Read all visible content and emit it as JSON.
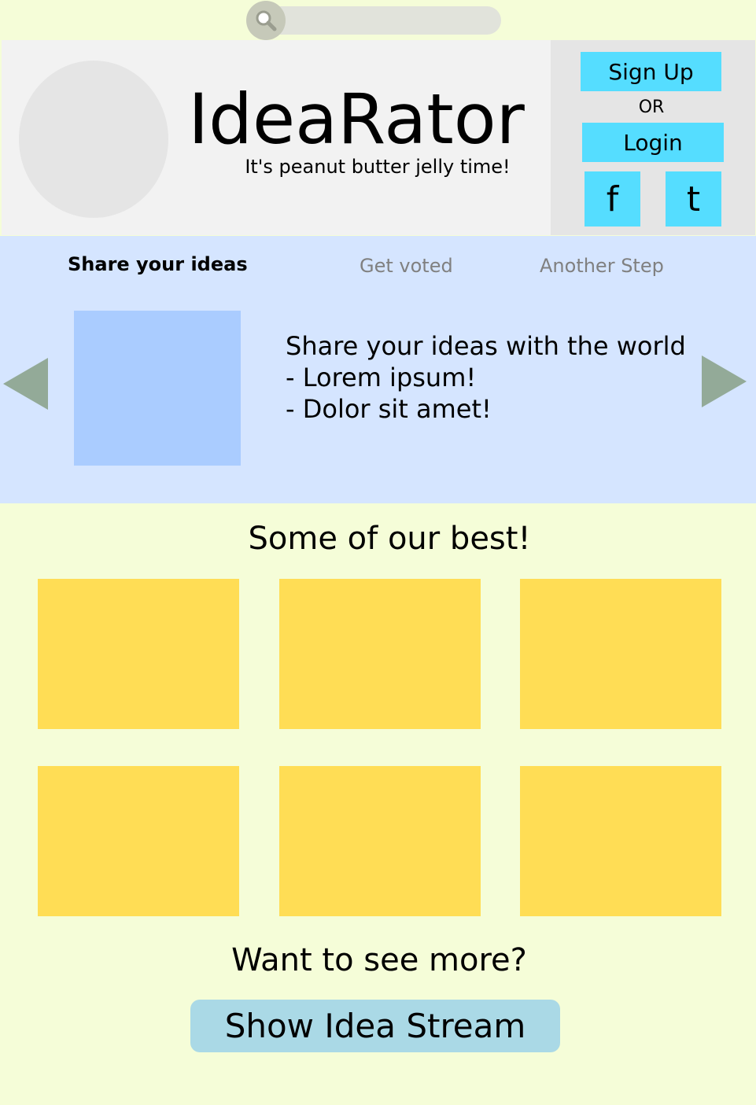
{
  "search": {
    "icon": "search-icon"
  },
  "header": {
    "title": "IdeaRator",
    "tagline": "It's peanut butter jelly time!"
  },
  "auth": {
    "signup_label": "Sign Up",
    "or_label": "OR",
    "login_label": "Login",
    "facebook_label": "f",
    "twitter_label": "t"
  },
  "steps": {
    "tabs": [
      {
        "label": "Share your ideas",
        "active": true
      },
      {
        "label": "Get voted",
        "active": false
      },
      {
        "label": "Another Step",
        "active": false
      }
    ],
    "slide_lines": [
      "Share your ideas with the world",
      "- Lorem ipsum!",
      "- Dolor sit amet!"
    ],
    "prev_icon": "triangle-left-icon",
    "next_icon": "triangle-right-icon"
  },
  "best": {
    "heading": "Some of our best!",
    "card_count": 6
  },
  "more": {
    "heading": "Want to see more?",
    "button_label": "Show Idea Stream"
  },
  "colors": {
    "page_background": "#f5fdd8",
    "header_background": "#f2f2f2",
    "auth_background": "#e5e5e5",
    "button_cyan": "#55ddff",
    "steps_background": "#d5e5ff",
    "carousel_image": "#aaccff",
    "arrow": "#93aa98",
    "idea_card": "#ffdd55",
    "stream_button": "#aad9e6"
  }
}
